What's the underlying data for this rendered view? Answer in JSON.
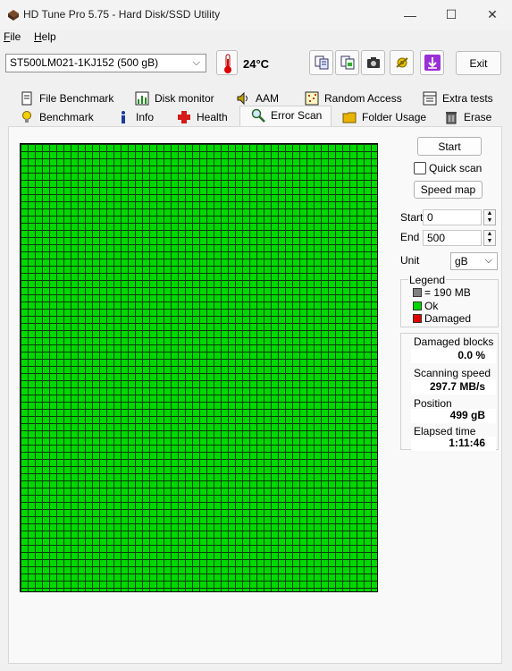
{
  "window": {
    "title": "HD Tune Pro 5.75 - Hard Disk/SSD Utility",
    "controls": {
      "minimize": "—",
      "maximize": "☐",
      "close": "✕"
    }
  },
  "menu": [
    {
      "label": "File",
      "accel": "F",
      "rest": "ile"
    },
    {
      "label": "Help",
      "accel": "H",
      "rest": "elp"
    }
  ],
  "toolbar": {
    "drive": "ST500LM021-1KJ152 (500 gB)",
    "temperature": "24°C",
    "exit_label": "Exit",
    "buttons": [
      "copy-info-icon",
      "copy-screenshot-icon",
      "camera-icon",
      "options-icon",
      "save-down-arrow-icon"
    ]
  },
  "tabs": {
    "row1": [
      "File Benchmark",
      "Disk monitor",
      "AAM",
      "Random Access",
      "Extra tests"
    ],
    "row2": [
      "Benchmark",
      "Info",
      "Health",
      "Error Scan",
      "Folder Usage",
      "Erase"
    ],
    "active": "Error Scan"
  },
  "error_scan": {
    "start_button": "Start",
    "quick_scan_label": "Quick scan",
    "quick_scan_checked": false,
    "speed_map_button": "Speed map",
    "start_label": "Start",
    "start_value": "0",
    "end_label": "End",
    "end_value": "500",
    "unit_label": "Unit",
    "unit_value": "gB",
    "legend_title": "Legend",
    "legend": [
      {
        "label": "= 190 MB",
        "color": "#808080"
      },
      {
        "label": "Ok",
        "color": "#00d800"
      },
      {
        "label": "Damaged",
        "color": "#e00000"
      }
    ],
    "block_state": "Ok",
    "stats": {
      "damaged_blocks_label": "Damaged blocks",
      "damaged_blocks_value": "0.0 %",
      "scanning_speed_label": "Scanning speed",
      "scanning_speed_value": "297.7 MB/s",
      "position_label": "Position",
      "position_value": "499 gB",
      "elapsed_label": "Elapsed time",
      "elapsed_value": "1:11:46"
    }
  }
}
